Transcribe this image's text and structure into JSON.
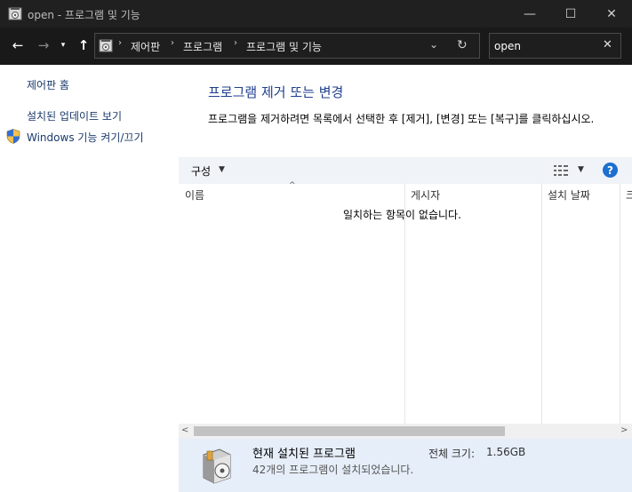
{
  "window": {
    "title": "open - 프로그램 및 기능",
    "minimize": "—",
    "maximize": "☐",
    "close": "✕"
  },
  "nav": {
    "back": "←",
    "forward": "→",
    "recent": "▾",
    "up": "↑"
  },
  "address": {
    "breadcrumbs": [
      "제어판",
      "프로그램",
      "프로그램 및 기능"
    ],
    "separator": "›",
    "dropdown": "⌄",
    "refresh": "↻"
  },
  "search": {
    "value": "open",
    "clear": "✕"
  },
  "sidebar": {
    "items": [
      {
        "label": "제어판 홈"
      },
      {
        "label": "설치된 업데이트 보기"
      },
      {
        "label": "Windows 기능 켜기/끄기",
        "icon": "shield-icon"
      }
    ]
  },
  "main": {
    "heading": "프로그램 제거 또는 변경",
    "description": "프로그램을 제거하려면 목록에서 선택한 후 [제거], [변경] 또는 [복구]를 클릭하십시오."
  },
  "toolbar": {
    "organize_label": "구성",
    "organize_arrow": "▼",
    "view_arrow": "▼",
    "help_label": "?"
  },
  "columns": {
    "headers": [
      "이름",
      "게시자",
      "설치 날짜",
      "크"
    ],
    "sort_indicator": "^"
  },
  "list": {
    "empty_message": "일치하는 항목이 없습니다."
  },
  "scrollbar": {
    "left_arrow": "<",
    "right_arrow": ">"
  },
  "details": {
    "title": "현재 설치된 프로그램",
    "total_size_label": "전체 크기:",
    "total_size_value": "1.56GB",
    "count_text": "42개의 프로그램이 설치되었습니다."
  },
  "colors": {
    "titlebar_bg": "#202020",
    "link_color": "#1b3a6b",
    "heading_color": "#1f3f8f",
    "details_bg": "#e6eef9",
    "help_blue": "#1c6fd1"
  }
}
